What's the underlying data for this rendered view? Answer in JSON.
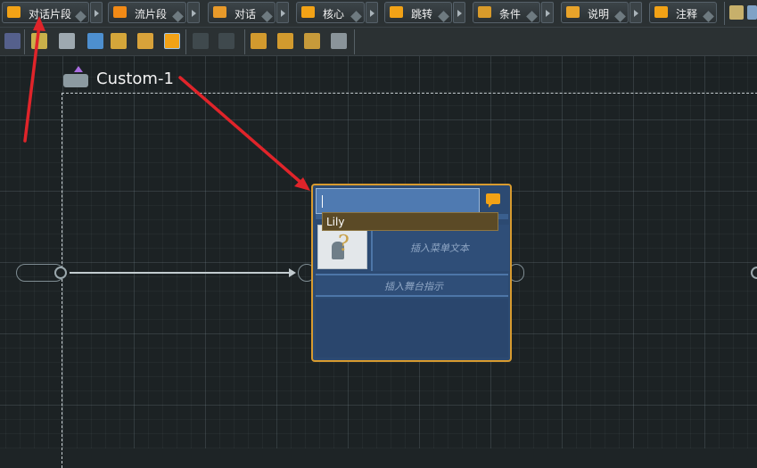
{
  "toolbar1": {
    "buttons": [
      {
        "label": "对话片段",
        "icon": "dialogue-fragment-icon",
        "color": "#f2a216"
      },
      {
        "label": "流片段",
        "icon": "flow-fragment-icon",
        "color": "#f28a16"
      },
      {
        "label": "对话",
        "icon": "dialogue-icon",
        "color": "#e89a2a"
      },
      {
        "label": "核心",
        "icon": "hub-icon",
        "color": "#f2a216"
      },
      {
        "label": "跳转",
        "icon": "jump-icon",
        "color": "#f2a216"
      },
      {
        "label": "条件",
        "icon": "condition-icon",
        "color": "#d99b2a"
      },
      {
        "label": "说明",
        "icon": "instruction-icon",
        "color": "#e8a32a"
      },
      {
        "label": "注释",
        "icon": "comment-icon",
        "color": "#f2a216"
      }
    ]
  },
  "canvas": {
    "flow_title": "Custom-1"
  },
  "node": {
    "speaker_value": "",
    "menu_text_placeholder": "插入菜单文本",
    "stage_directions_placeholder": "插入舞台指示",
    "border_color": "#d89b2f"
  },
  "autocomplete": {
    "items": [
      "Lily"
    ]
  },
  "annotations": {
    "arrow_color": "#e0242a"
  }
}
